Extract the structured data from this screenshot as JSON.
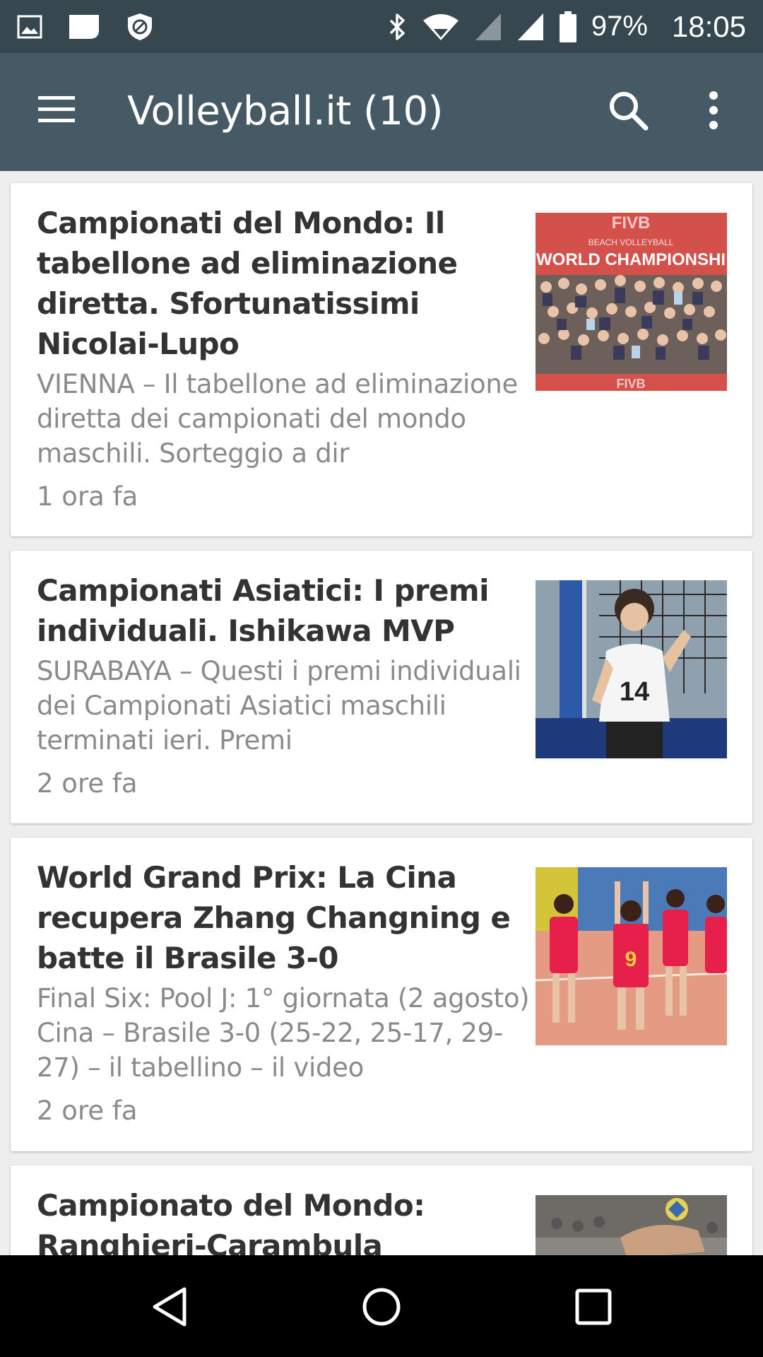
{
  "status_bar": {
    "battery": "97%",
    "time": "18:05",
    "left_icons": [
      "image-icon",
      "notification-badge-icon",
      "vpn-shield-icon"
    ],
    "right_icons": [
      "bluetooth-icon",
      "wifi-icon",
      "signal-icon",
      "signal-icon",
      "battery-icon"
    ]
  },
  "app_bar": {
    "title": "Volleyball.it (10)",
    "icons": [
      "menu-icon",
      "search-icon",
      "more-vert-icon"
    ]
  },
  "articles": [
    {
      "title": "Campionati del Mondo: Il tabellone ad eliminazione diretta. Sfortunatissimi Nicolai-Lupo",
      "snippet": "VIENNA – Il tabellone ad eliminazione diretta dei campionati del mondo maschili. Sorteggio a dir",
      "time": "1 ora fa",
      "thumb_text_top": "FIVB",
      "thumb_text_mid": "BEACH VOLLEYBALL",
      "thumb_text_main": "WORLD CHAMPIONSHI",
      "thumb_text_bottom": "FIVB"
    },
    {
      "title": "Campionati Asiatici: I premi individuali. Ishikawa MVP",
      "snippet": "SURABAYA – Questi i premi individuali dei Campionati Asiatici maschili terminati ieri. Premi",
      "time": "2 ore fa",
      "thumb_jersey": "14"
    },
    {
      "title": "World Grand Prix: La Cina recupera Zhang Changning e batte il Brasile 3-0",
      "snippet": "Final Six: Pool J: 1° giornata (2 agosto) Cina – Brasile 3-0 (25-22, 25-17, 29-27) – il tabellino  – il video",
      "time": "2 ore fa",
      "thumb_jersey": "9"
    },
    {
      "title": "Campionato del Mondo: Ranghieri-Carambula"
    }
  ],
  "nav_bar": {
    "icons": [
      "back-icon",
      "home-icon",
      "recents-icon"
    ]
  },
  "colors": {
    "status_bar": "#37474f",
    "app_bar": "#455a64",
    "background": "#eeeeee",
    "title_text": "#333333",
    "snippet_text": "#8a8a8a"
  }
}
